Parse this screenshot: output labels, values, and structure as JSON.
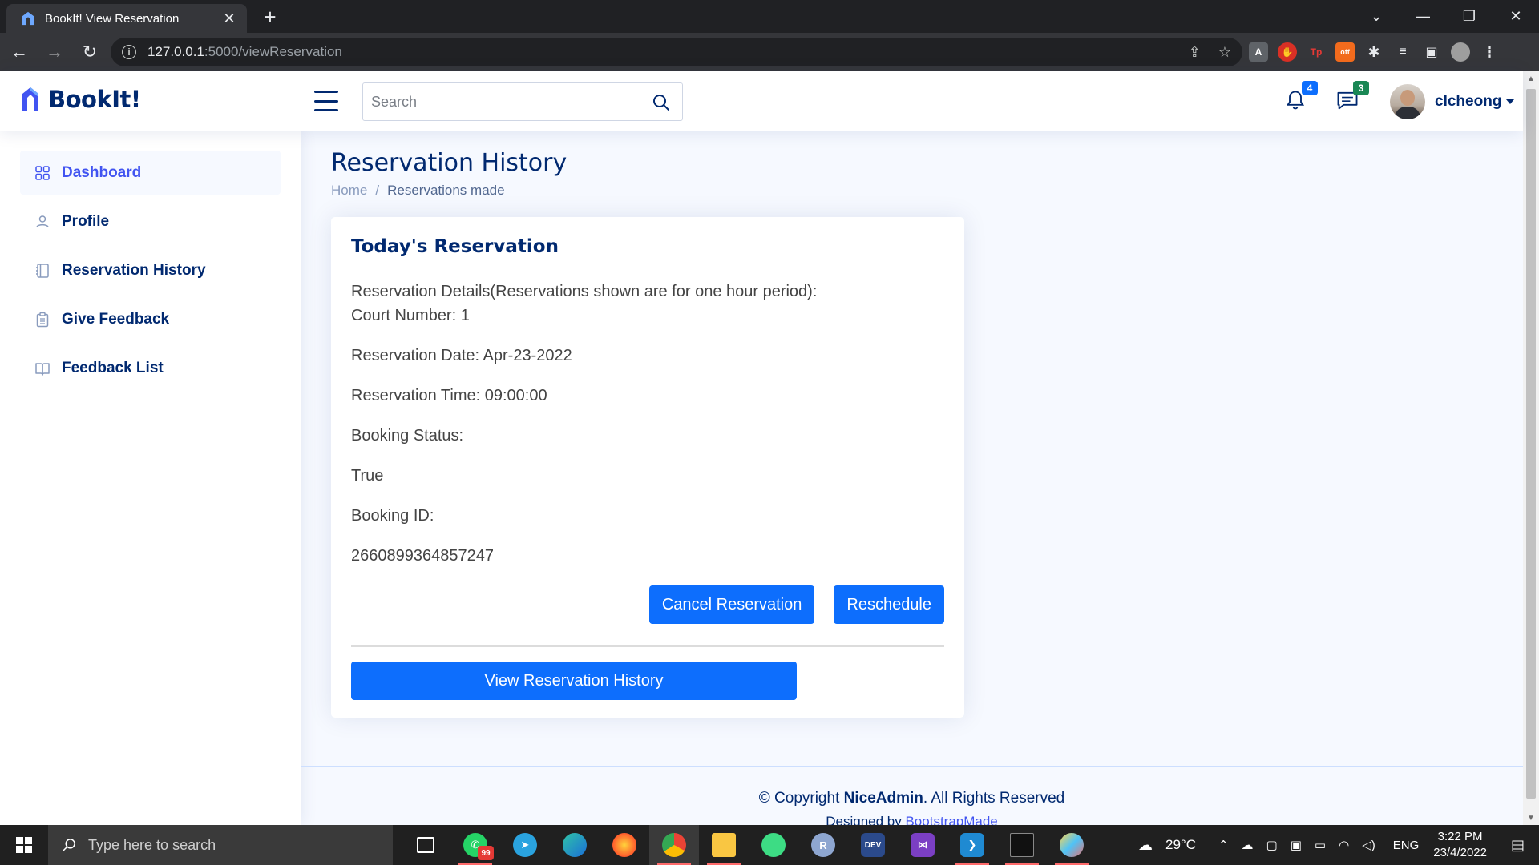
{
  "browser": {
    "tab_title": "BookIt! View Reservation",
    "url_host": "127.0.0.1",
    "url_path": ":5000/viewReservation"
  },
  "header": {
    "logo_text": "BookIt!",
    "search_placeholder": "Search",
    "notification_count": "4",
    "message_count": "3",
    "username": "clcheong"
  },
  "sidebar": {
    "items": [
      {
        "label": "Dashboard",
        "icon": "grid-icon"
      },
      {
        "label": "Profile",
        "icon": "person-icon"
      },
      {
        "label": "Reservation History",
        "icon": "journal-icon"
      },
      {
        "label": "Give Feedback",
        "icon": "clipboard-icon"
      },
      {
        "label": "Feedback List",
        "icon": "book-icon"
      }
    ]
  },
  "main": {
    "page_title": "Reservation History",
    "breadcrumb_home": "Home",
    "breadcrumb_sep": "/",
    "breadcrumb_current": "Reservations made",
    "card_title": "Today's Reservation",
    "details_heading": "Reservation Details(Reservations shown are for one hour period):",
    "court_number": "Court Number: 1",
    "reservation_date": "Reservation Date: Apr-23-2022",
    "reservation_time": "Reservation Time: 09:00:00",
    "booking_status_label": "Booking Status:",
    "booking_status_value": "True",
    "booking_id_label": "Booking ID:",
    "booking_id_value": "2660899364857247",
    "cancel_label": "Cancel Reservation",
    "reschedule_label": "Reschedule",
    "view_history_label": "View Reservation History",
    "footer_copyright_prefix": "© Copyright ",
    "footer_brand": "NiceAdmin",
    "footer_suffix": ". All Rights Reserved",
    "footer_designed_prefix": "Designed by ",
    "footer_designed_link": "BootstrapMade"
  },
  "taskbar": {
    "search_placeholder": "Type here to search",
    "weather": "29°C",
    "language": "ENG",
    "time": "3:22 PM",
    "date": "23/4/2022",
    "whatsapp_badge": "99"
  },
  "colors": {
    "brand_navy": "#012970",
    "accent": "#4154f1",
    "button_blue": "#0d6efd",
    "badge_green": "#198754"
  }
}
